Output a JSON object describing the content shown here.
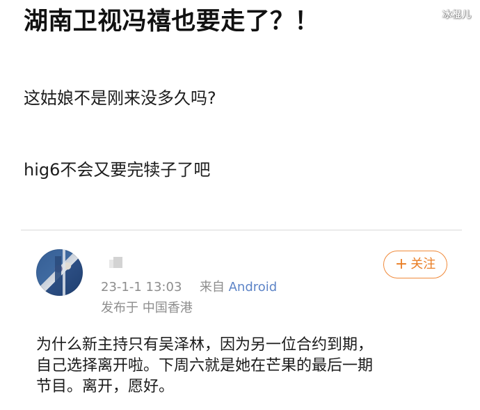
{
  "watermark": {
    "text": "冰棍儿"
  },
  "post": {
    "title": "湖南卫视冯禧也要走了？！",
    "lines": [
      "这姑娘不是刚来没多久吗?",
      "hig6不会又要完犊子了吧"
    ]
  },
  "comment": {
    "meta": {
      "timestamp": "23-1-1 13:03",
      "source_prefix": "来自",
      "source_value": "Android",
      "location": "发布于 中国香港"
    },
    "follow_button": {
      "icon": "plus-icon",
      "icon_text": "+",
      "label": "关注"
    },
    "body_lines": [
      "为什么新主持只有吴泽林，因为另一位合约到期，",
      "自己选择离开啦。下周六就是她在芒果的最后一期",
      "节目。离开，愿好。"
    ]
  },
  "colors": {
    "text_primary": "#111111",
    "text_secondary": "#8d8d8d",
    "accent_orange": "#e97d24",
    "accent_link_blue": "#5d84c7",
    "divider": "#d9d9d9"
  }
}
